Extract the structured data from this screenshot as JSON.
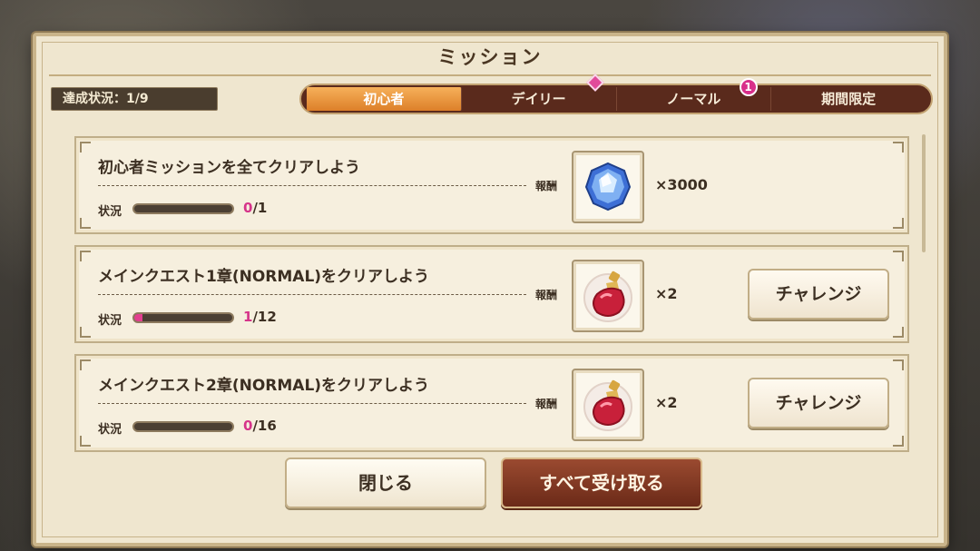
{
  "window": {
    "title": "ミッション"
  },
  "progress": {
    "label": "達成状況：1/9"
  },
  "tabs": [
    {
      "label": "初心者",
      "active": true
    },
    {
      "label": "デイリー",
      "marker": "pink-diamond"
    },
    {
      "label": "ノーマル",
      "badge": "1"
    },
    {
      "label": "期間限定"
    }
  ],
  "reward_label": "報酬",
  "status_label": "状況",
  "missions": [
    {
      "title": "初心者ミッションを全てクリアしよう",
      "progress_current": "0",
      "progress_total": "/1",
      "progress_fraction": 0,
      "reward_icon": "blue-gem-icon",
      "reward_qty": "×3000",
      "button": ""
    },
    {
      "title": "メインクエスト1章(NORMAL)をクリアしよう",
      "progress_current": "1",
      "progress_total": "/12",
      "progress_fraction": 0.083,
      "reward_icon": "red-potion-icon",
      "reward_qty": "×2",
      "button": "チャレンジ"
    },
    {
      "title": "メインクエスト2章(NORMAL)をクリアしよう",
      "progress_current": "0",
      "progress_total": "/16",
      "progress_fraction": 0,
      "reward_icon": "red-potion-icon",
      "reward_qty": "×2",
      "button": "チャレンジ"
    }
  ],
  "buttons": {
    "close": "閉じる",
    "receive_all": "すべて受け取る"
  },
  "colors": {
    "accent_tab": "#dd7f29",
    "progress_pink": "#e23f8f",
    "dark_brown": "#5a2a1c"
  }
}
